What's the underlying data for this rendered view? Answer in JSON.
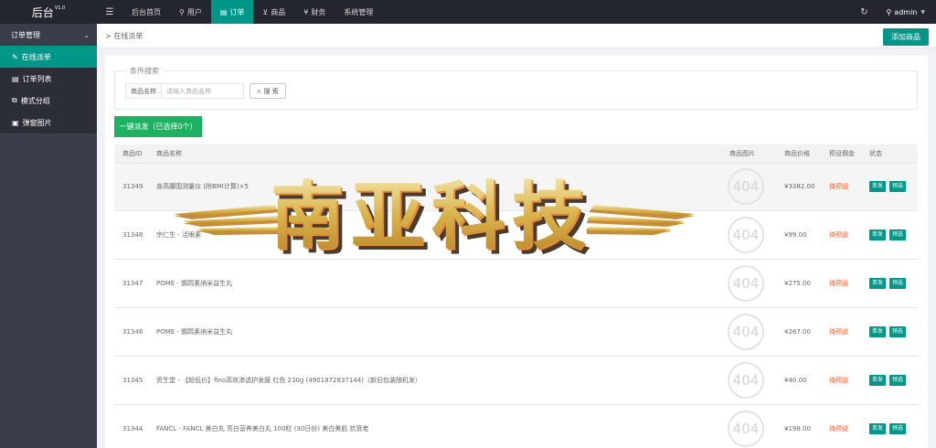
{
  "app": {
    "title": "后台",
    "version": "V1.0"
  },
  "topnav": {
    "items": [
      {
        "label": "后台首页",
        "icon": "home-icon"
      },
      {
        "label": "用户",
        "icon": "user-icon"
      },
      {
        "label": "订单",
        "icon": "order-icon"
      },
      {
        "label": "商品",
        "icon": "cart-icon"
      },
      {
        "label": "财务",
        "icon": "yen-icon"
      },
      {
        "label": "系统管理",
        "icon": ""
      }
    ],
    "active": "订单",
    "user": "admin"
  },
  "sidebar": {
    "group": "订单管理",
    "items": [
      {
        "label": "在线派单",
        "icon": "edit-icon",
        "active": true
      },
      {
        "label": "订单列表",
        "icon": "list-icon",
        "active": false
      },
      {
        "label": "模式分组",
        "icon": "group-icon",
        "active": false
      },
      {
        "label": "弹窗图片",
        "icon": "image-icon",
        "active": false
      }
    ]
  },
  "breadcrumb": {
    "current": "在线派单"
  },
  "header": {
    "add_button": "添加商品"
  },
  "search": {
    "legend": "条件搜索",
    "label": "商品名称",
    "placeholder": "请输入商品名称",
    "button": "搜 索"
  },
  "bulk_button": "一键派发（已选择0个）",
  "table": {
    "columns": [
      "商品ID",
      "商品名称",
      "商品图片",
      "商品价格",
      "预设佣金",
      "状态"
    ],
    "rows": [
      {
        "id": "31349",
        "name": "身高腰围测量仪 (附BMI计算)×5",
        "image": "404",
        "price": "¥3382.00",
        "commission": "待预设"
      },
      {
        "id": "31348",
        "name": "宗仁生 - 活眼素",
        "image": "404",
        "price": "¥99.00",
        "commission": "待预设"
      },
      {
        "id": "31347",
        "name": "POME - 鹦鹉素纳米益生丸",
        "image": "404",
        "price": "¥275.00",
        "commission": "待预设"
      },
      {
        "id": "31346",
        "name": "POME - 鹦鹉素纳米益生丸",
        "image": "404",
        "price": "¥267.00",
        "commission": "待预设"
      },
      {
        "id": "31345",
        "name": "资生堂 - 【超低价】fino高效渗透护发膜 红色 230g (4901872837144)（新旧包装随机发）",
        "image": "404",
        "price": "¥40.00",
        "commission": "待预设"
      },
      {
        "id": "31344",
        "name": "FANCL - FANCL 美白丸 亮白营养美白丸 100粒 (30日份) 美白美肌 抗衰老",
        "image": "404",
        "price": "¥198.00",
        "commission": "待预设"
      }
    ],
    "actions": {
      "dispatch": "单发",
      "preselect": "预选"
    }
  },
  "watermark": {
    "text": "南亚科技"
  },
  "colors": {
    "primary": "#009688",
    "topbar": "#23262e",
    "sidebar": "#393d49",
    "bulk": "#1fb162",
    "pending": "#ff5722"
  }
}
